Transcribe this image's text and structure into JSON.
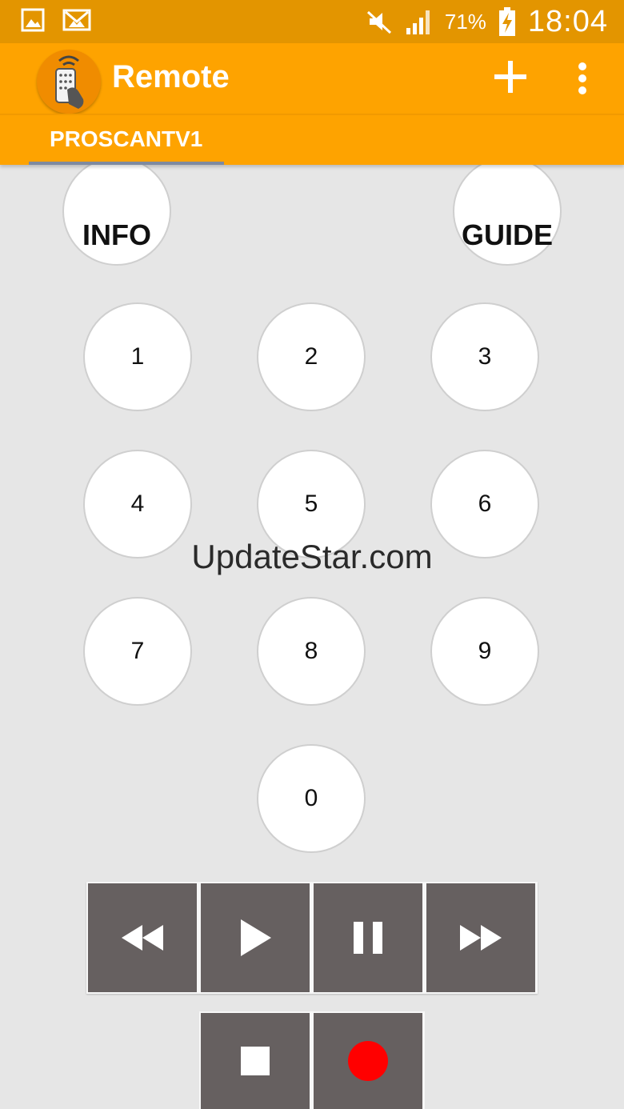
{
  "status_bar": {
    "battery": "71%",
    "time": "18:04",
    "icons": [
      "gallery-icon",
      "gmail-icon",
      "mute-icon",
      "signal-icon",
      "battery-charging-icon"
    ]
  },
  "app_bar": {
    "title": "Remote",
    "logo_icon": "remote-hand-icon",
    "add_icon": "plus-icon",
    "menu_icon": "more-vert-icon"
  },
  "tabs": [
    {
      "label": "PROSCANTV1",
      "selected": true
    }
  ],
  "remote": {
    "info": "INFO",
    "guide": "GUIDE",
    "digits": [
      "1",
      "2",
      "3",
      "4",
      "5",
      "6",
      "7",
      "8",
      "9",
      "0"
    ],
    "transport": [
      "rewind-icon",
      "play-icon",
      "pause-icon",
      "fast-forward-icon",
      "stop-icon",
      "record-icon"
    ]
  },
  "watermark": "UpdateStar.com",
  "colors": {
    "status_bar": "#e39500",
    "app_bar": "#fea300",
    "background": "#e6e6e6",
    "transport_button": "#666060",
    "record": "#ff0000"
  }
}
